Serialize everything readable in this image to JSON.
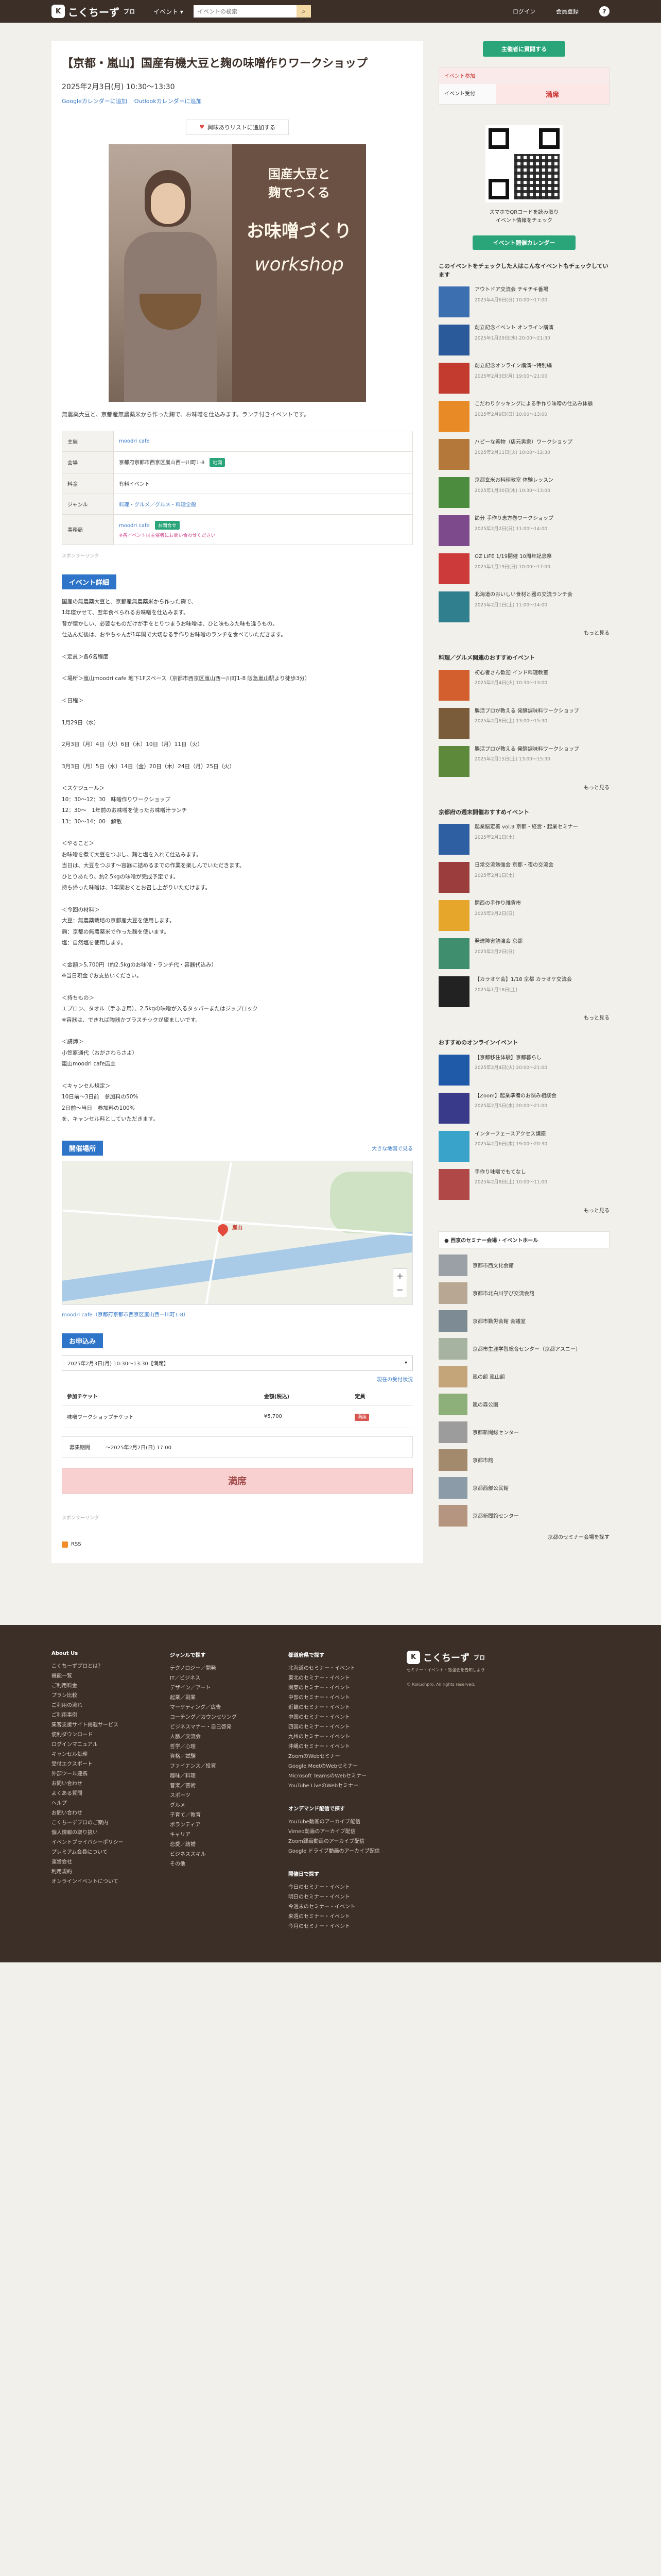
{
  "header": {
    "logo_text": "こくちーず",
    "logo_sub": "プロ",
    "events_label": "イベント ▾",
    "search_placeholder": "イベントの検索",
    "login": "ログイン",
    "register": "会員登録",
    "help": "?"
  },
  "event": {
    "title": "【京都・嵐山】国産有機大豆と麹の味噌作りワークショップ",
    "datetime": "2025年2月3日(月) 10:30〜13:30",
    "google_cal": "Googleカレンダーに追加",
    "outlook_cal": "Outlookカレンダーに追加",
    "wishlist": "興味ありリストに追加する",
    "board_line1": "国産大豆と",
    "board_line2": "麹でつくる",
    "board_line3": "お味噌づくり",
    "board_line4": "workshop",
    "lead": "無農薬大豆と、京都産無農薬米から作った麹で、お味噌を仕込みます。ランチ付きイベントです。",
    "info": [
      {
        "k": "主催",
        "v": "moodri cafe"
      },
      {
        "k": "会場",
        "v": "京都府京都市西京区嵐山西一川町1-8",
        "tag": "地図"
      },
      {
        "k": "料金",
        "v": "有料イベント"
      },
      {
        "k": "ジャンル",
        "v": "料理・グルメ／グルメ・料理全般"
      },
      {
        "k": "事務局",
        "v": "moodri cafe",
        "tag": "お問合せ",
        "note": "※各イベントは主催者にお問い合わせください"
      }
    ],
    "sponsor_note": "スポンサーリンク",
    "detail_label": "イベント詳細",
    "detail_lines": [
      "国産の無農薬大豆と、京都産無農薬米から作った麹で、",
      "1年寝かせて、翌年食べられるお味噌を仕込みます。",
      "昔が懐かしい、必要なものだけが手をとりつまうお味噌は、ひと味もふた味も違うもの。",
      "仕込んだ後は、おやちゃんが1年間で大切なる手作りお味噌のランチを食べていただきます。",
      "",
      "＜定員＞各6名程度",
      "",
      "＜場所＞嵐山moodri cafe 地下1Fスペース（京都市西京区嵐山西一川町1-8 阪急嵐山駅より徒歩3分）",
      "",
      "＜日程＞",
      "",
      "1月29日（水）",
      "",
      "2月3日（月）4日（火）6日（木）10日（月）11日（火）",
      "",
      "3月3日（月）5日（水）14日（金）20日（木）24日（月）25日（火）",
      "",
      "＜スケジュール＞",
      "10：30〜12：30　味噌作りワークショップ",
      "12：30〜　1年前のお味噌を使ったお味噌汁ランチ",
      "13：30〜14：00　解散",
      "",
      "＜やること＞",
      "お味噌を煮て大豆をつぶし、麹と塩を入れて仕込みます。",
      "当日は、大豆をつぶす〜容器に詰めるまでの作業を楽しんでいただきます。",
      "ひとりあたり、約2.5kgの味噌が完成予定です。",
      "持ち帰った味噌は、1年間おくとお召し上がりいただけます。",
      "",
      "＜今回の材料＞",
      "大豆：無農薬栽培の京都産大豆を使用します。",
      "麹：京都の無農薬米で作った麹を使います。",
      "塩：自然塩を使用します。",
      "",
      "＜金額＞5,700円（約2.5kgのお味噌・ランチ代・容器代込み）",
      "※当日現金でお支払いください。",
      "",
      "＜持ちもの＞",
      "エプロン、タオル（手ふき用）、2.5kgの味噌が入るタッパーまたはジップロック",
      "※容器は、できれば陶器かプラスチックが望ましいです。",
      "",
      "＜講師＞",
      "小笠原通代（おがさわらさよ）",
      "嵐山moodri cafe店主",
      "",
      "＜キャンセル規定＞",
      "10日前〜3日前　参加料の50%",
      "2日前〜当日　参加料の100%",
      "を、キャンセル料としていただきます。"
    ],
    "map_label": "開催場所",
    "map_link": "大きな地図で見る",
    "map_place": "嵐山",
    "map_addr": "moodri cafe（京都府京都市西京区嵐山西一川町1-8）",
    "apply_label": "お申込み",
    "ticket_select": "2025年2月3日(月) 10:30〜13:30【満席】",
    "ticket_note": "現在の受付状況",
    "ticket_cols": [
      "参加チケット",
      "金額(税込)",
      "定員"
    ],
    "ticket_name": "味噌ワークショップチケット",
    "ticket_price": "¥5,700",
    "ticket_status": "満席",
    "deadline_label": "募集期間",
    "deadline_value": "〜2025年2月2日(日) 17:00",
    "full_button": "満席",
    "report_note": "スポンサーリンク",
    "rss": "RSS"
  },
  "side": {
    "cta": "主催者に質問する",
    "status_head": "イベント参加",
    "status_key": "イベント受付",
    "status_value": "満席",
    "qr_text": "スマホでQRコードを読み取り\nイベント情報をチェック",
    "calendar_btn": "イベント開催カレンダー",
    "recent_heading": "このイベントをチェックした人はこんなイベントもチェックしています",
    "recent": [
      {
        "t": "アウトドア交流会 チキチキ番場",
        "d": "2025年4月6日(日) 10:00〜17:00",
        "c": "#3b6fb0"
      },
      {
        "t": "創立記念イベント オンライン講演",
        "d": "2025年1月29日(水) 20:00〜21:30",
        "c": "#2a5a9a"
      },
      {
        "t": "創立記念オンライン講演〜特別編",
        "d": "2025年2月3日(月) 19:00〜21:00",
        "c": "#c33a2e"
      },
      {
        "t": "こだわりクッキングによる手作り味噌の仕込み体験",
        "d": "2025年2月9日(日) 10:00〜13:00",
        "c": "#e88a25"
      },
      {
        "t": "ハピーな着物（店元男衆）ワークショップ",
        "d": "2025年2月11日(火) 10:00〜12:30",
        "c": "#b3783a"
      },
      {
        "t": "京都玄米お料理教室 体験レッスン",
        "d": "2025年1月30日(木) 10:30〜13:00",
        "c": "#4c8c3e"
      },
      {
        "t": "節分 手作り恵方巻ワークショップ",
        "d": "2025年2月2日(日) 11:00〜14:00",
        "c": "#7d4a8c"
      },
      {
        "t": "OZ LIFE 1/19開催 10周年記念祭",
        "d": "2025年1月19日(日) 10:00〜17:00",
        "c": "#cc3a3a"
      },
      {
        "t": "北海道のおいしい食材と器の交流ランチ会",
        "d": "2025年2月1日(土) 11:00〜14:00",
        "c": "#2f7f8f"
      }
    ],
    "food_heading": "料理／グルメ関連のおすすめイベント",
    "food": [
      {
        "t": "初心者さん歓迎 インド料理教室",
        "d": "2025年2月4日(火) 10:30〜13:00",
        "c": "#d35f2e"
      },
      {
        "t": "腸活プロが教える 発酵調味料ワークショップ",
        "d": "2025年2月8日(土) 13:00〜15:30",
        "c": "#7a5c3a"
      },
      {
        "t": "腸活プロが教える 発酵調味料ワークショップ",
        "d": "2025年2月15日(土) 13:00〜15:30",
        "c": "#5d8a3a"
      }
    ],
    "kyoto_heading": "京都府の週末開催おすすめイベント",
    "kyoto": [
      {
        "t": "起業脳定着 vol.9 京都・経営・起業セミナー",
        "d": "2025年2月1日(土)",
        "c": "#2e5fa3"
      },
      {
        "t": "日常交流勉強会 京都・夜の交流会",
        "d": "2025年2月1日(土)",
        "c": "#9b3d3d"
      },
      {
        "t": "関西の手作り雑貨市",
        "d": "2025年2月2日(日)",
        "c": "#e5a62b"
      },
      {
        "t": "発達障害勉強会 京都",
        "d": "2025年2月2日(日)",
        "c": "#3f8e6e"
      },
      {
        "t": "【カラオケ会】1/18 京都 カラオケ交流会",
        "d": "2025年1月18日(土)",
        "c": "#222222"
      }
    ],
    "online_heading": "おすすめのオンラインイベント",
    "online": [
      {
        "t": "【京都移住体験】京都暮らし",
        "d": "2025年2月4日(火) 20:00〜21:00",
        "c": "#1f5aa8"
      },
      {
        "t": "【Zoom】起業準備のお悩み相談会",
        "d": "2025年2月5日(水) 20:00〜21:00",
        "c": "#3a3a8a"
      },
      {
        "t": "インターフェースアクセス講座",
        "d": "2025年2月6日(木) 19:00〜20:30",
        "c": "#3aa3c9"
      },
      {
        "t": "手作り味噌でもてなし",
        "d": "2025年2月8日(土) 10:00〜11:00",
        "c": "#b04848"
      }
    ],
    "venue_heading": "● 西京のセミナー会場・イベントホール",
    "venues": [
      {
        "t": "京都市西文化会館",
        "c": "#9aa0a6"
      },
      {
        "t": "京都市北白川学び交流会館",
        "c": "#b8a792"
      },
      {
        "t": "京都市勤労会館 会議室",
        "c": "#7d8b95"
      },
      {
        "t": "京都市生涯学習総合センター（京都アスニー）",
        "c": "#a6b3a0"
      },
      {
        "t": "嵐の館 嵐山館",
        "c": "#c4a57a"
      },
      {
        "t": "嵐の森公園",
        "c": "#8db07a"
      },
      {
        "t": "京都新聞総センター",
        "c": "#9c9c9c"
      },
      {
        "t": "京都市館",
        "c": "#a38a6c"
      },
      {
        "t": "京都西部公民館",
        "c": "#8c9ba8"
      },
      {
        "t": "京都新聞館センター",
        "c": "#b59580"
      }
    ],
    "venue_more": "京都のセミナー会場を探す",
    "more": "もっと見る"
  },
  "footer": {
    "col1_title": "About Us",
    "col1": [
      "こくちーずプロとは？",
      "機能一覧",
      "ご利用料金",
      "プラン比較",
      "ご利用の流れ",
      "ご利用事例",
      "集客支援サイト掲載サービス",
      "便利ダウンロード",
      "ログインマニュアル",
      "キャンセル処理",
      "受付エクスポート",
      "外部ツール連携",
      "お問い合わせ",
      "よくある質問",
      "ヘルプ",
      "お問い合わせ",
      "こくちーずプロのご案内",
      "個人情報の取り扱い",
      "イベントプライバシーポリシー",
      "プレミアム会員について",
      "運営会社",
      "利用規約",
      "オンラインイベントについて"
    ],
    "col2_title": "ジャンルで探す",
    "col2": [
      "テクノロジー／開発",
      "IT／ビジネス",
      "デザイン／アート",
      "起業／副業",
      "マーケティング／広告",
      "コーチング／カウンセリング",
      "ビジネスマナー・自己啓発",
      "人脈／交流会",
      "哲学／心理",
      "資格／試験",
      "ファイナンス／投資",
      "趣味／料理",
      "音楽／芸術",
      "スポーツ",
      "グルメ",
      "子育て／教育",
      "ボランティア",
      "キャリア",
      "恋愛／結婚",
      "ビジネススキル",
      "その他"
    ],
    "col3_title": "都道府県で探す",
    "col3": [
      "北海道のセミナー・イベント",
      "東北のセミナー・イベント",
      "関東のセミナー・イベント",
      "中部のセミナー・イベント",
      "近畿のセミナー・イベント",
      "中国のセミナー・イベント",
      "四国のセミナー・イベント",
      "九州のセミナー・イベント",
      "沖縄のセミナー・イベント",
      "ZoomのWebセミナー",
      "Google MeetのWebセミナー",
      "Microsoft TeamsのWebセミナー",
      "YouTube LiveのWebセミナー"
    ],
    "col3b_title": "オンデマンド配信で探す",
    "col3b": [
      "YouTube動画のアーカイブ配信",
      "Vimeo動画のアーカイブ配信",
      "Zoom録画動画のアーカイブ配信",
      "Google ドライブ動画のアーカイブ配信"
    ],
    "col3c_title": "開催日で探す",
    "col3c": [
      "今日のセミナー・イベント",
      "明日のセミナー・イベント",
      "今週末のセミナー・イベント",
      "来週のセミナー・イベント",
      "今月のセミナー・イベント"
    ],
    "brand_sub": "セミナー・イベント・勉強会を告知しよう",
    "copy": "© Kokuchpro. All rights reserved."
  }
}
